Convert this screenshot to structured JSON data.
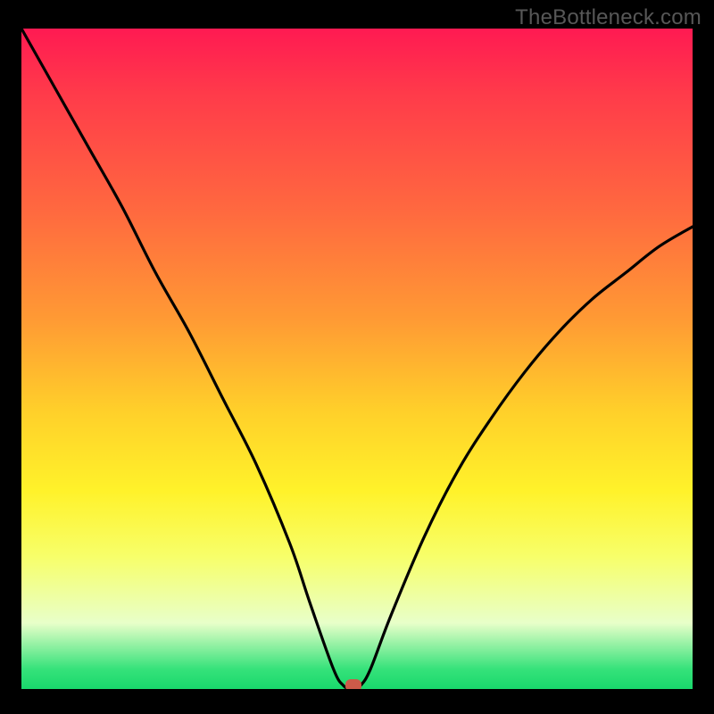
{
  "watermark": "TheBottleneck.com",
  "chart_data": {
    "type": "line",
    "title": "",
    "xlabel": "",
    "ylabel": "",
    "xlim": [
      0,
      100
    ],
    "ylim": [
      0,
      100
    ],
    "grid": false,
    "series": [
      {
        "name": "bottleneck-curve",
        "x": [
          0,
          5,
          10,
          15,
          20,
          25,
          30,
          35,
          40,
          43,
          46.5,
          48,
          49,
          49.5,
          50.5,
          52,
          55,
          60,
          65,
          70,
          75,
          80,
          85,
          90,
          95,
          100
        ],
        "values": [
          100,
          91,
          82,
          73,
          63,
          54,
          44,
          34,
          22,
          13,
          3,
          0.5,
          0,
          0,
          0.5,
          3,
          11,
          23,
          33,
          41,
          48,
          54,
          59,
          63,
          67,
          70
        ]
      }
    ],
    "marker": {
      "x": 49.5,
      "y": 0,
      "color": "#cc5a49"
    },
    "gradient_stops": [
      {
        "pos": 0,
        "color": "#ff1a52"
      },
      {
        "pos": 10,
        "color": "#ff3b4a"
      },
      {
        "pos": 28,
        "color": "#ff6a3f"
      },
      {
        "pos": 44,
        "color": "#ff9a34"
      },
      {
        "pos": 58,
        "color": "#ffd02a"
      },
      {
        "pos": 70,
        "color": "#fff22a"
      },
      {
        "pos": 80,
        "color": "#f7ff6a"
      },
      {
        "pos": 90,
        "color": "#e8ffc9"
      },
      {
        "pos": 97,
        "color": "#35e27a"
      },
      {
        "pos": 100,
        "color": "#19d86c"
      }
    ]
  }
}
